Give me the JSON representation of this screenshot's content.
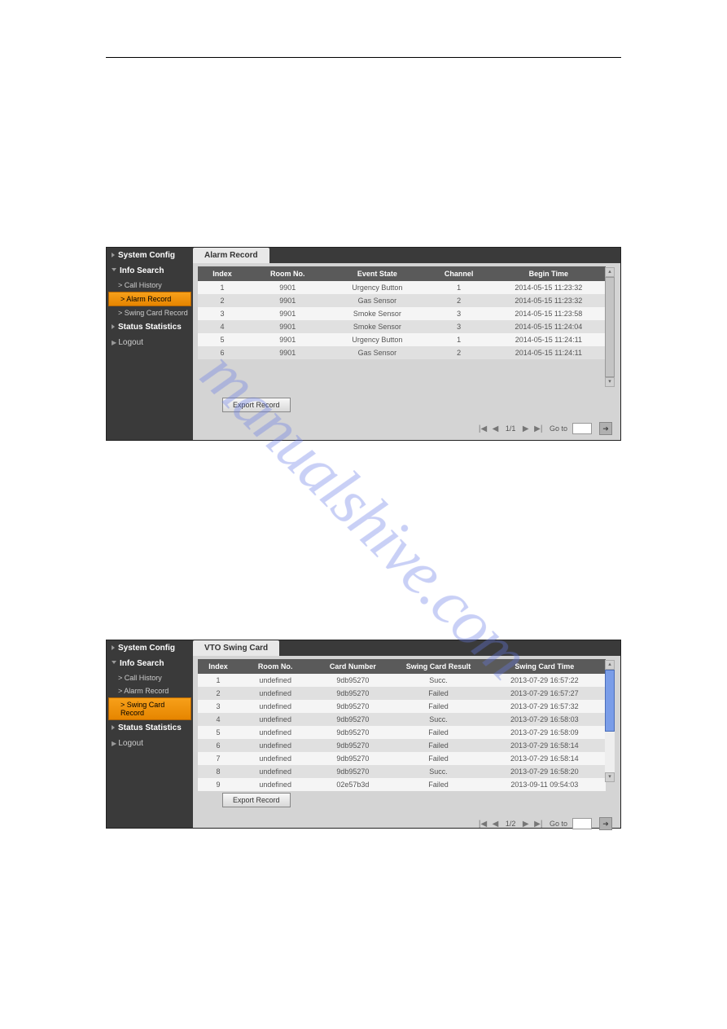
{
  "nav": {
    "system_config": "System Config",
    "info_search": "Info Search",
    "call_history": "Call History",
    "alarm_record": "Alarm Record",
    "swing_card_record": "Swing Card Record",
    "status_statistics": "Status Statistics",
    "logout": "Logout"
  },
  "alarm": {
    "tab": "Alarm Record",
    "cols": {
      "index": "Index",
      "room": "Room No.",
      "event": "Event State",
      "channel": "Channel",
      "time": "Begin Time"
    },
    "rows": [
      {
        "i": "1",
        "room": "9901",
        "event": "Urgency Button",
        "ch": "1",
        "t": "2014-05-15 11:23:32"
      },
      {
        "i": "2",
        "room": "9901",
        "event": "Gas Sensor",
        "ch": "2",
        "t": "2014-05-15 11:23:32"
      },
      {
        "i": "3",
        "room": "9901",
        "event": "Smoke Sensor",
        "ch": "3",
        "t": "2014-05-15 11:23:58"
      },
      {
        "i": "4",
        "room": "9901",
        "event": "Smoke Sensor",
        "ch": "3",
        "t": "2014-05-15 11:24:04"
      },
      {
        "i": "5",
        "room": "9901",
        "event": "Urgency Button",
        "ch": "1",
        "t": "2014-05-15 11:24:11"
      },
      {
        "i": "6",
        "room": "9901",
        "event": "Gas Sensor",
        "ch": "2",
        "t": "2014-05-15 11:24:11"
      }
    ],
    "export": "Export Record",
    "page": "1/1",
    "goto": "Go to"
  },
  "swing": {
    "tab": "VTO Swing Card",
    "cols": {
      "index": "Index",
      "room": "Room No.",
      "card": "Card Number",
      "result": "Swing Card Result",
      "time": "Swing Card Time"
    },
    "rows": [
      {
        "i": "1",
        "room": "undefined",
        "card": "9db95270",
        "res": "Succ.",
        "t": "2013-07-29 16:57:22"
      },
      {
        "i": "2",
        "room": "undefined",
        "card": "9db95270",
        "res": "Failed",
        "t": "2013-07-29 16:57:27"
      },
      {
        "i": "3",
        "room": "undefined",
        "card": "9db95270",
        "res": "Failed",
        "t": "2013-07-29 16:57:32"
      },
      {
        "i": "4",
        "room": "undefined",
        "card": "9db95270",
        "res": "Succ.",
        "t": "2013-07-29 16:58:03"
      },
      {
        "i": "5",
        "room": "undefined",
        "card": "9db95270",
        "res": "Failed",
        "t": "2013-07-29 16:58:09"
      },
      {
        "i": "6",
        "room": "undefined",
        "card": "9db95270",
        "res": "Failed",
        "t": "2013-07-29 16:58:14"
      },
      {
        "i": "7",
        "room": "undefined",
        "card": "9db95270",
        "res": "Failed",
        "t": "2013-07-29 16:58:14"
      },
      {
        "i": "8",
        "room": "undefined",
        "card": "9db95270",
        "res": "Succ.",
        "t": "2013-07-29 16:58:20"
      },
      {
        "i": "9",
        "room": "undefined",
        "card": "02e57b3d",
        "res": "Failed",
        "t": "2013-09-11 09:54:03"
      }
    ],
    "export": "Export Record",
    "page": "1/2",
    "goto": "Go to"
  },
  "watermark": "manualshive.com"
}
